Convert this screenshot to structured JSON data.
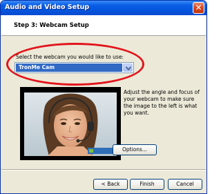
{
  "window": {
    "title": "Audio and Video Setup",
    "close_glyph": "✕"
  },
  "header": {
    "step_title": "Step 3: Webcam Setup"
  },
  "webcam_select": {
    "label": "Select the webcam you would like to use:",
    "selected_value": "TronMe Cam",
    "arrow_icon": "chevron-down-icon"
  },
  "preview": {
    "image": "webcam-preview-woman-with-headset"
  },
  "instructions": {
    "text": "Adjust the angle and focus of your webcam to make sure the image to the left is what you want."
  },
  "buttons": {
    "options": "Options...",
    "back": "< Back",
    "finish": "Finish",
    "cancel": "Cancel"
  },
  "colors": {
    "titlebar": "#0a5fe6",
    "selection": "#316ac5",
    "highlight_ring": "#e2141b",
    "dialog_bg": "#ece9d8"
  }
}
